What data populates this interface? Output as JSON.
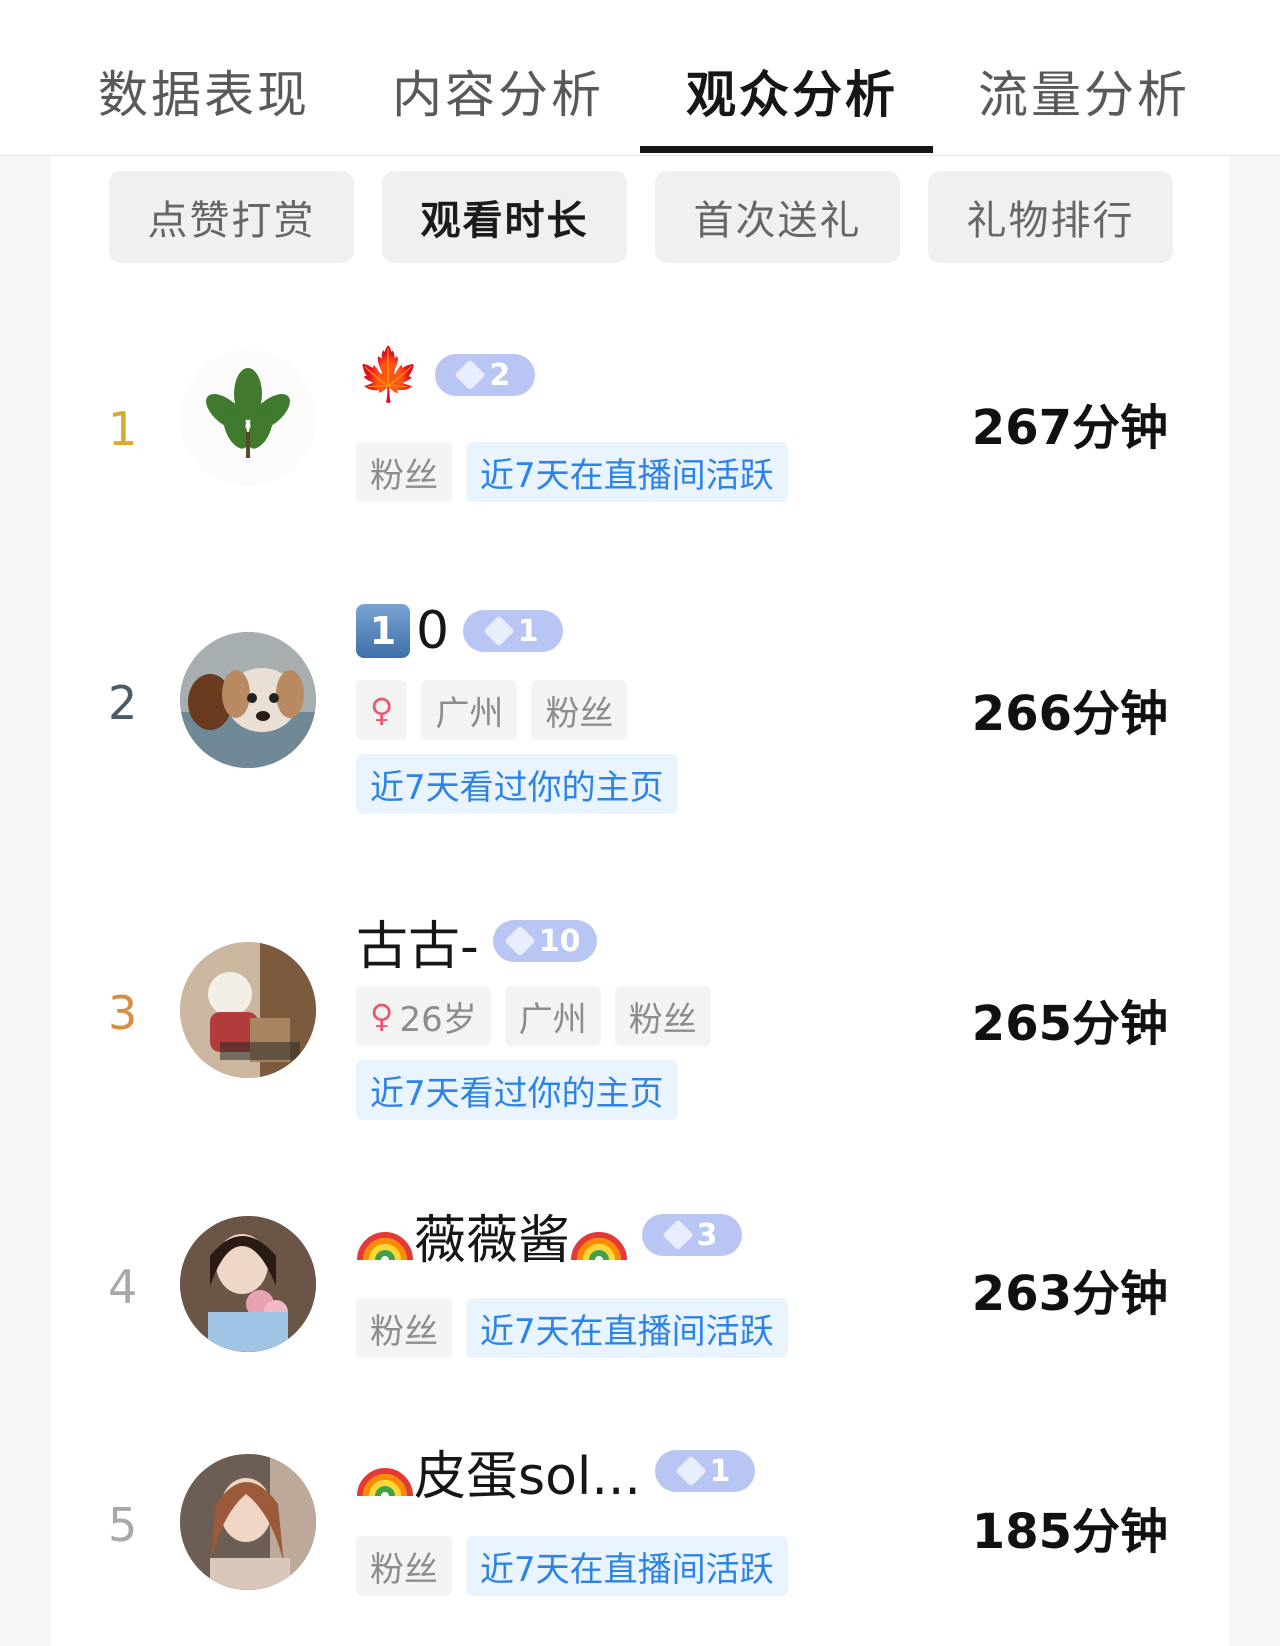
{
  "top_tabs": [
    {
      "label": "数据表现"
    },
    {
      "label": "内容分析"
    },
    {
      "label": "观众分析"
    },
    {
      "label": "流量分析"
    }
  ],
  "sub_tabs": [
    {
      "label": "点赞打赏"
    },
    {
      "label": "观看时长"
    },
    {
      "label": "首次送礼"
    },
    {
      "label": "礼物排行"
    }
  ],
  "rows": [
    {
      "rank": "1",
      "name": "",
      "badge_level": "2",
      "tags": [
        "粉丝"
      ],
      "activity": "近7天在直播间活跃",
      "duration": "267分钟"
    },
    {
      "rank": "2",
      "name_key": "1",
      "name": "0",
      "badge_level": "1",
      "tags": [
        "广州",
        "粉丝"
      ],
      "activity": "近7天看过你的主页",
      "duration": "266分钟"
    },
    {
      "rank": "3",
      "name": "古古-",
      "badge_level": "10",
      "age": "26岁",
      "tags": [
        "广州",
        "粉丝"
      ],
      "activity": "近7天看过你的主页",
      "duration": "265分钟"
    },
    {
      "rank": "4",
      "name": "薇薇酱",
      "badge_level": "3",
      "tags": [
        "粉丝"
      ],
      "activity": "近7天在直播间活跃",
      "duration": "263分钟"
    },
    {
      "rank": "5",
      "name": "皮蛋sol...",
      "badge_level": "1",
      "tags": [
        "粉丝"
      ],
      "activity": "近7天在直播间活跃",
      "duration": "185分钟"
    }
  ],
  "colors": {
    "rank1": "#d9a82f",
    "rank2": "#4b5b68",
    "rank3": "#d98e3f",
    "rank_other": "#a8a8a8",
    "badge": "#b9c6f4",
    "activity_text": "#2d83e6"
  }
}
